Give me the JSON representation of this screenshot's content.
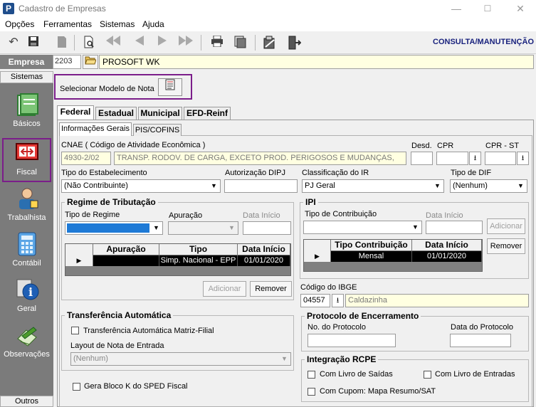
{
  "window": {
    "title": "Cadastro de Empresas",
    "app_icon_letter": "P",
    "controls": [
      "—",
      "☐",
      "✕"
    ]
  },
  "menu": [
    "Opções",
    "Ferramentas",
    "Sistemas",
    "Ajuda"
  ],
  "toolbar": {
    "mode_label": "CONSULTA/MANUTENÇÃO",
    "buttons": [
      "undo-icon",
      "save-icon",
      "save-disabled-icon",
      "preview-icon",
      "first-icon",
      "prev-icon",
      "next-icon",
      "last-icon",
      "print-icon",
      "print-batch-icon",
      "tools-icon",
      "exit-icon"
    ]
  },
  "empresa": {
    "label": "Empresa",
    "code": "2203",
    "name": "PROSOFT WK"
  },
  "sidebar": {
    "header": "Sistemas",
    "footer": "Outros",
    "items": [
      {
        "label": "Básicos",
        "icon": "basicos-icon",
        "color": "#3a9a3a"
      },
      {
        "label": "Fiscal",
        "icon": "fiscal-icon",
        "color": "#8b1a1a"
      },
      {
        "label": "Trabalhista",
        "icon": "trabalhista-icon",
        "color": "#2a6fb0"
      },
      {
        "label": "Contábil",
        "icon": "contabil-icon",
        "color": "#4a8fd0"
      },
      {
        "label": "Geral",
        "icon": "geral-icon",
        "color": "#1e5fb5"
      },
      {
        "label": "Observações",
        "icon": "observacoes-icon",
        "color": "#4c9a2a"
      }
    ]
  },
  "modelo": {
    "label": "Selecionar Modelo de Nota"
  },
  "tabs": [
    "Federal",
    "Estadual",
    "Municipal",
    "EFD-Reinf"
  ],
  "subtabs": [
    "Informações Gerais",
    "PIS/COFINS"
  ],
  "form": {
    "cnae_label": "CNAE ( Código de  Atividade Econômica )",
    "cnae_code": "4930-2/02",
    "cnae_desc": "TRANSP. RODOV. DE CARGA, EXCETO PROD. PERIGOSOS E MUDANÇAS,",
    "desd_label": "Desd.",
    "cpr_label": "CPR",
    "cpr_st_label": "CPR - ST",
    "tipo_estab_label": "Tipo do Estabelecimento",
    "tipo_estab_value": "(Não Contribuinte)",
    "aut_dipj_label": "Autorização DIPJ",
    "class_ir_label": "Classificação do IR",
    "class_ir_value": "PJ Geral",
    "tipo_dif_label": "Tipo de DIF",
    "tipo_dif_value": "(Nenhum)"
  },
  "regime": {
    "title": "Regime de Tributação",
    "tipo_label": "Tipo de Regime",
    "apuracao_label": "Apuração",
    "data_inicio_label": "Data Início",
    "columns": [
      "Apuração",
      "Tipo",
      "Data Início"
    ],
    "rows": [
      {
        "apuracao": "",
        "tipo": "Simp. Nacional - EPP",
        "data": "01/01/2020"
      }
    ],
    "add_label": "Adicionar",
    "remove_label": "Remover"
  },
  "ipi": {
    "title": "IPI",
    "tipo_label": "Tipo de Contribuição",
    "data_inicio_label": "Data Início",
    "add_label": "Adicionar",
    "remove_label": "Remover",
    "columns": [
      "Tipo Contribuição",
      "Data Início"
    ],
    "rows": [
      {
        "tipo": "Mensal",
        "data": "01/01/2020"
      }
    ]
  },
  "ibge": {
    "label": "Código do IBGE",
    "code": "04557",
    "city": "Caldazinha"
  },
  "transferencia": {
    "title": "Transferência Automática",
    "check_label": "Transferência Automática Matriz-Filial",
    "layout_label": "Layout de Nota de Entrada",
    "layout_value": "(Nenhum)"
  },
  "bloco_k": {
    "label": "Gera Bloco K do SPED Fiscal"
  },
  "protocolo": {
    "title": "Protocolo de Encerramento",
    "num_label": "No. do Protocolo",
    "data_label": "Data do Protocolo"
  },
  "rcpe": {
    "title": "Integração RCPE",
    "saidas_label": "Com Livro de Saídas",
    "entradas_label": "Com Livro de Entradas",
    "cupom_label": "Com Cupom: Mapa Resumo/SAT"
  }
}
